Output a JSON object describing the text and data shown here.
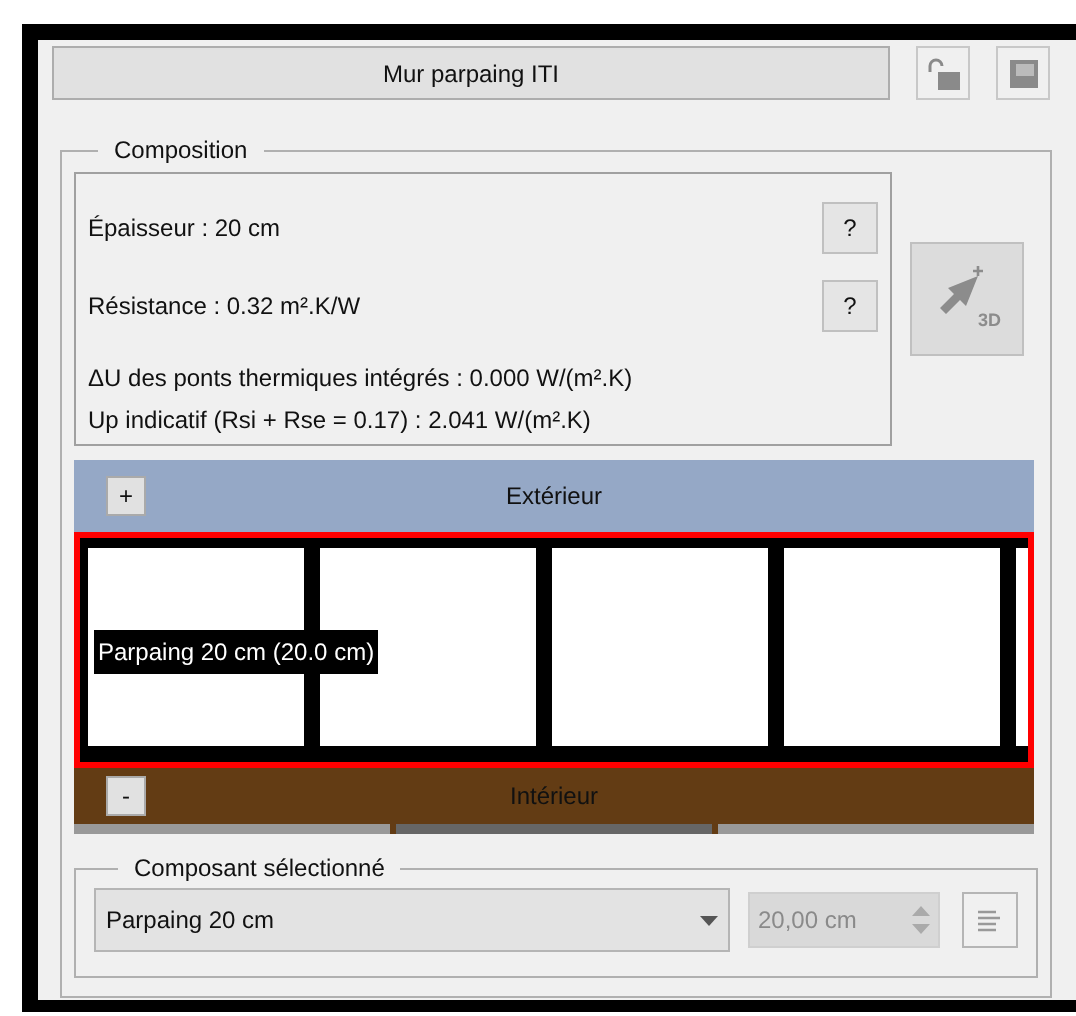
{
  "title_button": "Mur parpaing ITI",
  "toolbar": [
    {
      "kind": "lock",
      "disabled": true
    },
    {
      "kind": "save",
      "disabled": true
    }
  ],
  "composition": {
    "label": "Composition",
    "properties": [
      {
        "text": "Épaisseur : 20 cm",
        "help": "?"
      },
      {
        "text": "Résistance : 0.32 m².K/W",
        "help": "?"
      },
      {
        "text": "ΔU des ponts thermiques intégrés : 0.000 W/(m².K)"
      },
      {
        "text": "Up indicatif (Rsi + Rse = 0.17) : 2.041 W/(m².K)"
      }
    ],
    "view_3d_button": {
      "label": "3D",
      "disabled": true
    },
    "exterior": {
      "toggle": "+",
      "label": "Extérieur",
      "color": "#95a8c6"
    },
    "layers": [
      {
        "label": "Parpaing 20 cm (20.0 cm)",
        "selected": true
      }
    ],
    "interior": {
      "toggle": "-",
      "label": "Intérieur",
      "color": "#633c14"
    }
  },
  "selected_component": {
    "label": "Composant sélectionné",
    "material": "Parpaing 20 cm",
    "thickness": "20,00 cm",
    "thickness_disabled": true
  }
}
